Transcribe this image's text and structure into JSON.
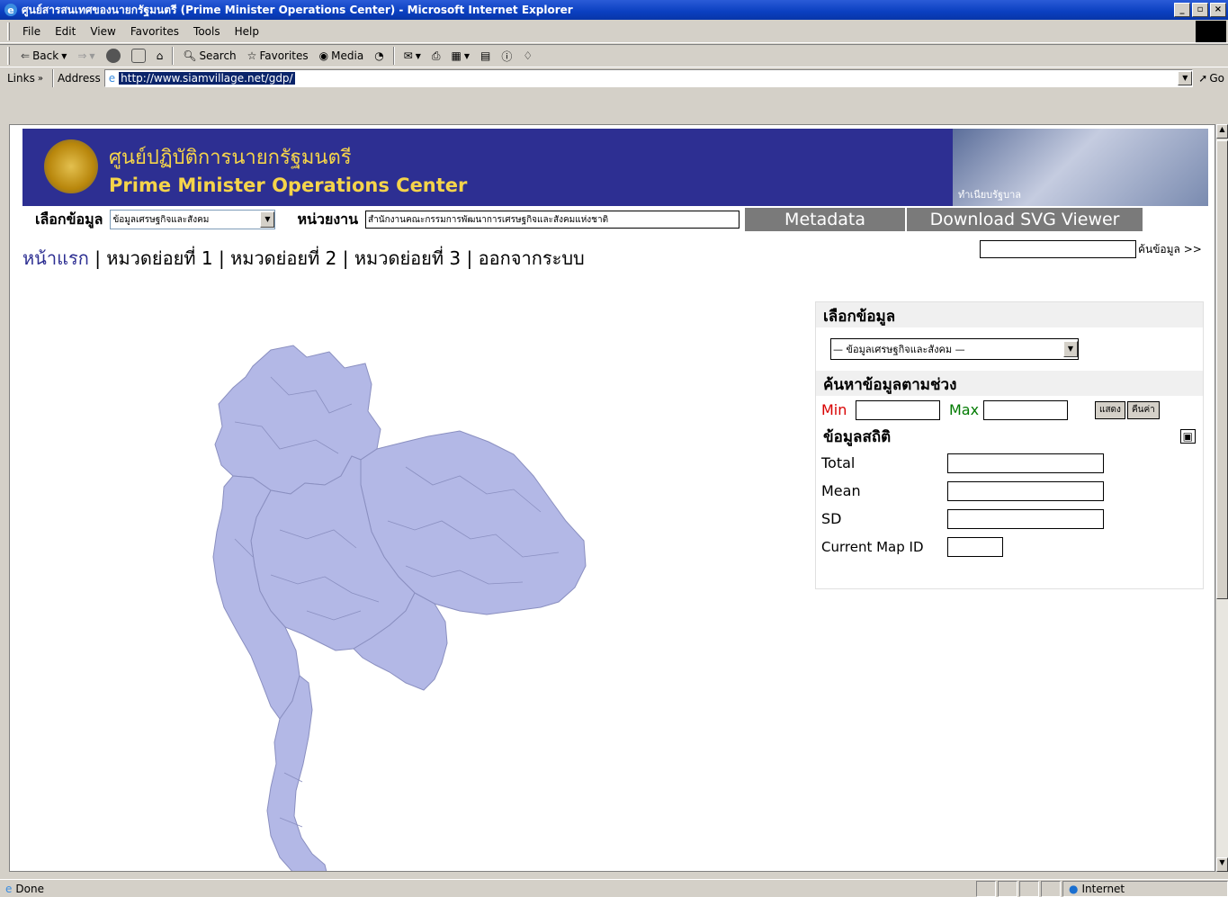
{
  "window": {
    "title": "ศูนย์สารสนเทศของนายกรัฐมนตรี (Prime Minister Operations Center) - Microsoft Internet Explorer"
  },
  "menu": {
    "items": [
      "File",
      "Edit",
      "View",
      "Favorites",
      "Tools",
      "Help"
    ]
  },
  "toolbar": {
    "back": "Back",
    "search": "Search",
    "favorites": "Favorites",
    "media": "Media"
  },
  "address": {
    "links_label": "Links",
    "address_label": "Address",
    "url": "http://www.siamvillage.net/gdp/",
    "go_label": "Go"
  },
  "banner": {
    "title_th": "ศูนย์ปฏิบัติการนายกรัฐมนตรี",
    "title_en": "Prime Minister Operations Center",
    "photo_caption": "ทำเนียบรัฐบาล"
  },
  "selector": {
    "data_label": "เลือกข้อมูล",
    "data_value": "ข้อมูลเศรษฐกิจและสังคม",
    "agency_label": "หน่วยงาน",
    "agency_value": "สำนักงานคณะกรรมการพัฒนาการเศรษฐกิจและสังคมแห่งชาติ",
    "metadata_tab": "Metadata",
    "svg_tab": "Download SVG Viewer"
  },
  "nav": {
    "home": "หน้าแรก",
    "sub1": "หมวดย่อยที่ 1",
    "sub2": "หมวดย่อยที่ 2",
    "sub3": "หมวดย่อยที่ 3",
    "logout": "ออกจากระบบ",
    "search_label": "ค้นข้อมูล >>"
  },
  "panel": {
    "select_title": "เลือกข้อมูล",
    "select_value": "— ข้อมูลเศรษฐกิจและสังคม —",
    "range_title": "ค้นหาข้อมูลตามช่วง",
    "min_label": "Min",
    "max_label": "Max",
    "show_button": "แสดง",
    "reset_button": "คืนค่า",
    "stats_title": "ข้อมูลสถิติ",
    "total_label": "Total",
    "mean_label": "Mean",
    "sd_label": "SD",
    "mapid_label": "Current Map ID"
  },
  "colors": {
    "banner": "#2d2f92",
    "banner_text": "#f5d44a",
    "map_fill": "#b3b8e6",
    "min_color": "#d80000",
    "max_color": "#007a00"
  },
  "status": {
    "text": "Done",
    "zone": "Internet"
  }
}
